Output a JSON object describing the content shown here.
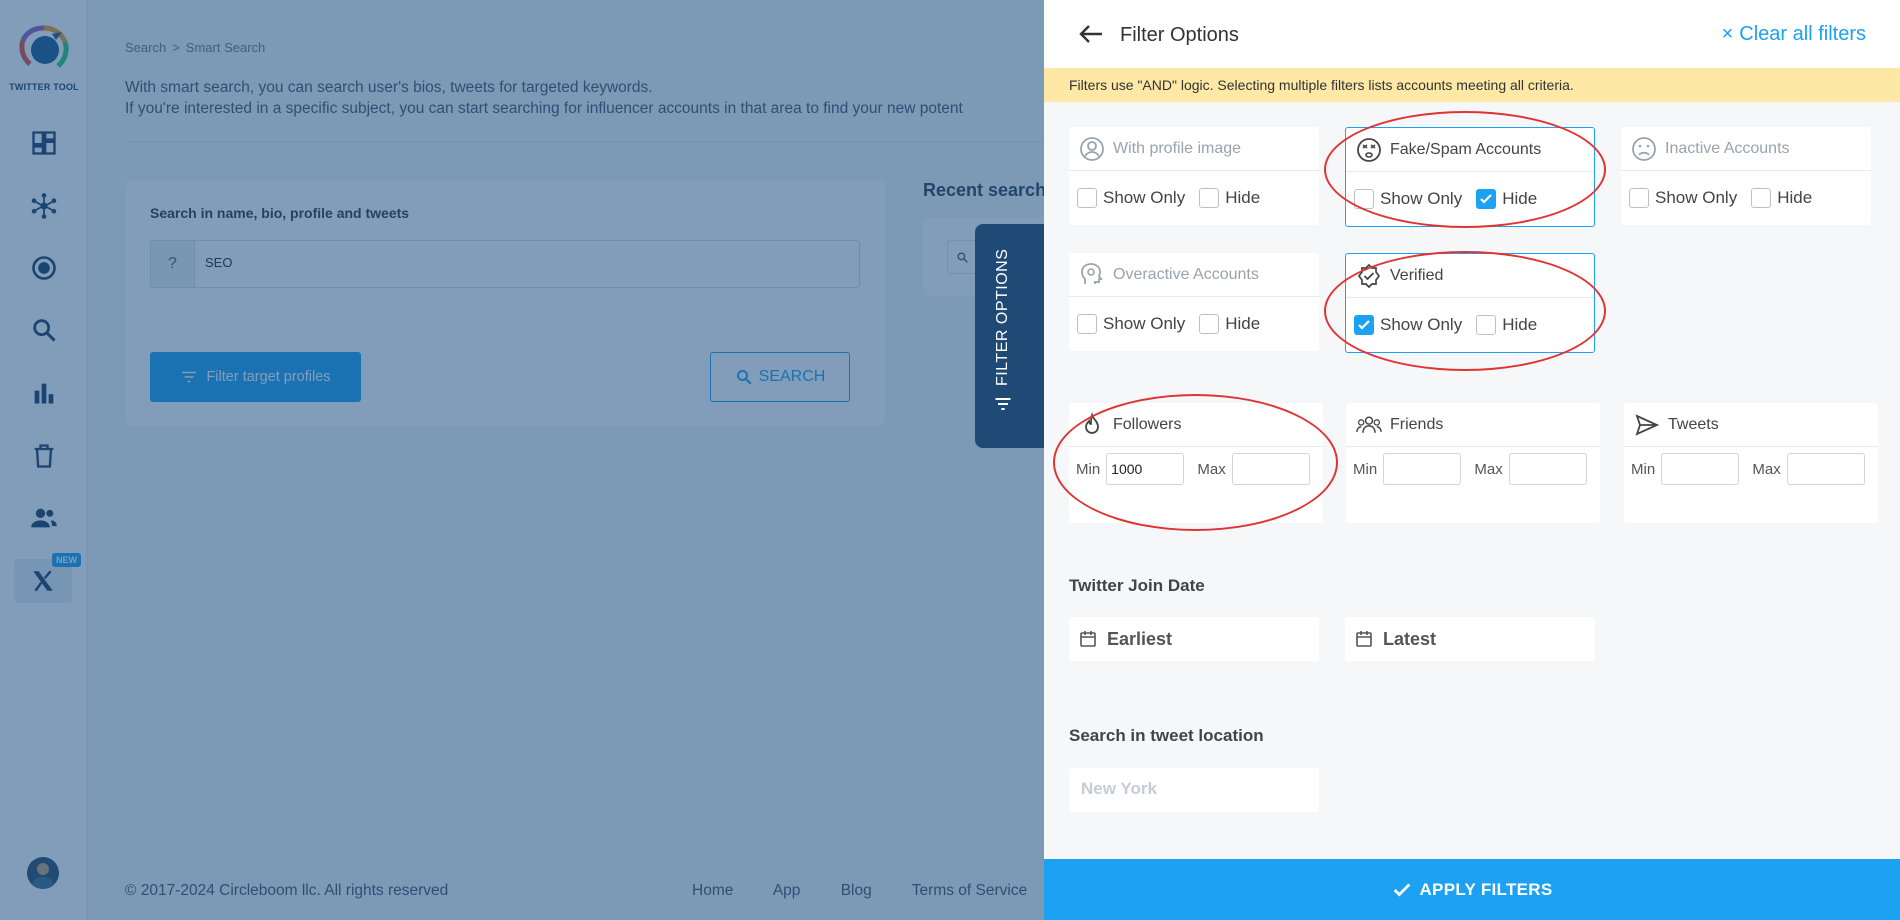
{
  "app": {
    "logo_text": "TWITTER TOOL",
    "new_badge": "NEW"
  },
  "breadcrumb": {
    "root": "Search",
    "sep": ">",
    "current": "Smart Search"
  },
  "intro": {
    "line1": "With smart search, you can search user's bios, tweets for targeted keywords.",
    "line2": "If you're interested in a specific subject, you can start searching for influencer accounts in that area to find your new potent"
  },
  "search": {
    "label": "Search in name, bio, profile and tweets",
    "prefix": "?",
    "value": "SEO",
    "filter_button": "Filter target profiles",
    "search_button": "SEARCH"
  },
  "recent": {
    "title": "Recent search"
  },
  "vertical_tab": {
    "label": "FILTER OPTIONS"
  },
  "footer": {
    "copyright": "© 2017-2024 Circleboom llc. All rights reserved",
    "links": [
      "Home",
      "App",
      "Blog",
      "Terms of Service"
    ]
  },
  "panel": {
    "title": "Filter Options",
    "clear_all": "Clear all filters",
    "notice": "Filters use \"AND\" logic. Selecting multiple filters lists accounts meeting all criteria.",
    "show_only": "Show Only",
    "hide": "Hide",
    "filters": {
      "profile_image": {
        "label": "With profile image",
        "show_only": false,
        "hide": false
      },
      "fake_spam": {
        "label": "Fake/Spam Accounts",
        "show_only": false,
        "hide": true
      },
      "inactive": {
        "label": "Inactive Accounts",
        "show_only": false,
        "hide": false
      },
      "overactive": {
        "label": "Overactive Accounts",
        "show_only": false,
        "hide": false
      },
      "verified": {
        "label": "Verified",
        "show_only": true,
        "hide": false
      }
    },
    "ranges": {
      "min_label": "Min",
      "max_label": "Max",
      "followers": {
        "label": "Followers",
        "min": "1000",
        "max": ""
      },
      "friends": {
        "label": "Friends",
        "min": "",
        "max": ""
      },
      "tweets": {
        "label": "Tweets",
        "min": "",
        "max": ""
      }
    },
    "join_date": {
      "title": "Twitter Join Date",
      "earliest": "Earliest",
      "latest": "Latest"
    },
    "location": {
      "title": "Search in tweet location",
      "placeholder": "New York"
    },
    "apply": "APPLY FILTERS"
  },
  "colors": {
    "accent": "#1da1f2",
    "tab_bg": "#1e4a75",
    "notice_bg": "#fde8a6",
    "annotation": "#e03333"
  }
}
